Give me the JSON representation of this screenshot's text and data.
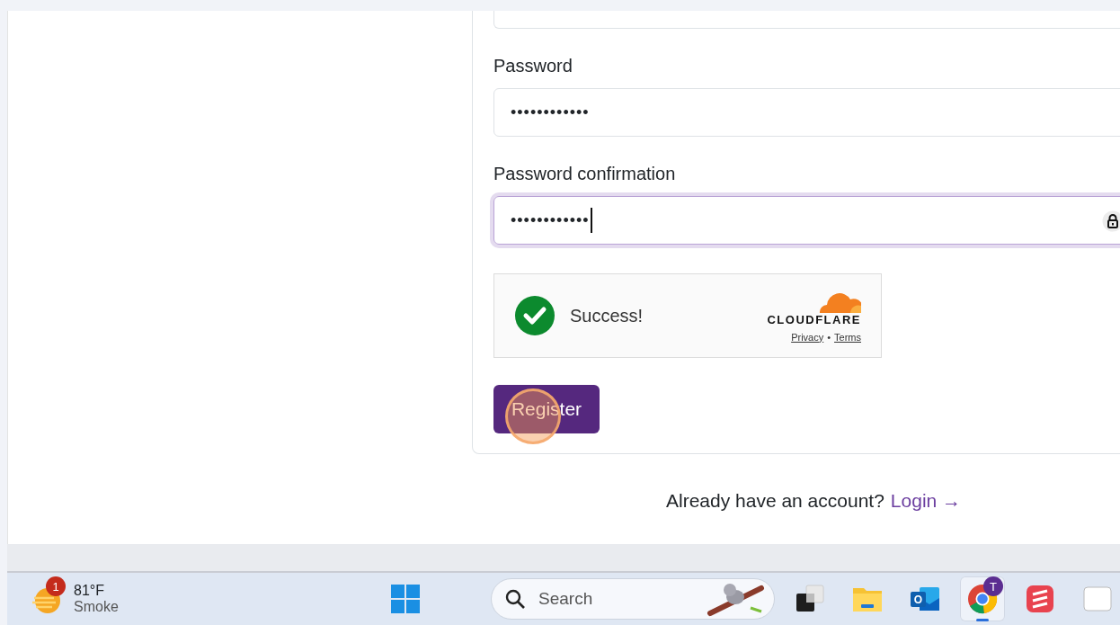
{
  "form": {
    "fields": [
      {
        "label": "Password",
        "value": "••••••••••••",
        "focused": false
      },
      {
        "label": "Password confirmation",
        "value": "••••••••••••",
        "focused": true
      }
    ],
    "captcha": {
      "status": "Success!",
      "brand": "CLOUDFLARE",
      "links": [
        "Privacy",
        "Terms"
      ],
      "separator": "•"
    },
    "submit": "Register"
  },
  "login_prompt": {
    "question": "Already have an account?",
    "link": "Login →"
  },
  "taskbar": {
    "weather": {
      "badge": "1",
      "temperature": "81°F",
      "condition": "Smoke"
    },
    "search": {
      "placeholder": "Search"
    },
    "apps": [
      {
        "kind": "windows",
        "selected": false
      },
      {
        "kind": "taskview",
        "selected": false
      },
      {
        "kind": "folder",
        "selected": false
      },
      {
        "kind": "mail",
        "selected": false,
        "letter": "O"
      },
      {
        "kind": "browser",
        "selected": true,
        "badge": "T"
      },
      {
        "kind": "notes",
        "selected": false
      },
      {
        "kind": "partial",
        "selected": false
      }
    ]
  }
}
